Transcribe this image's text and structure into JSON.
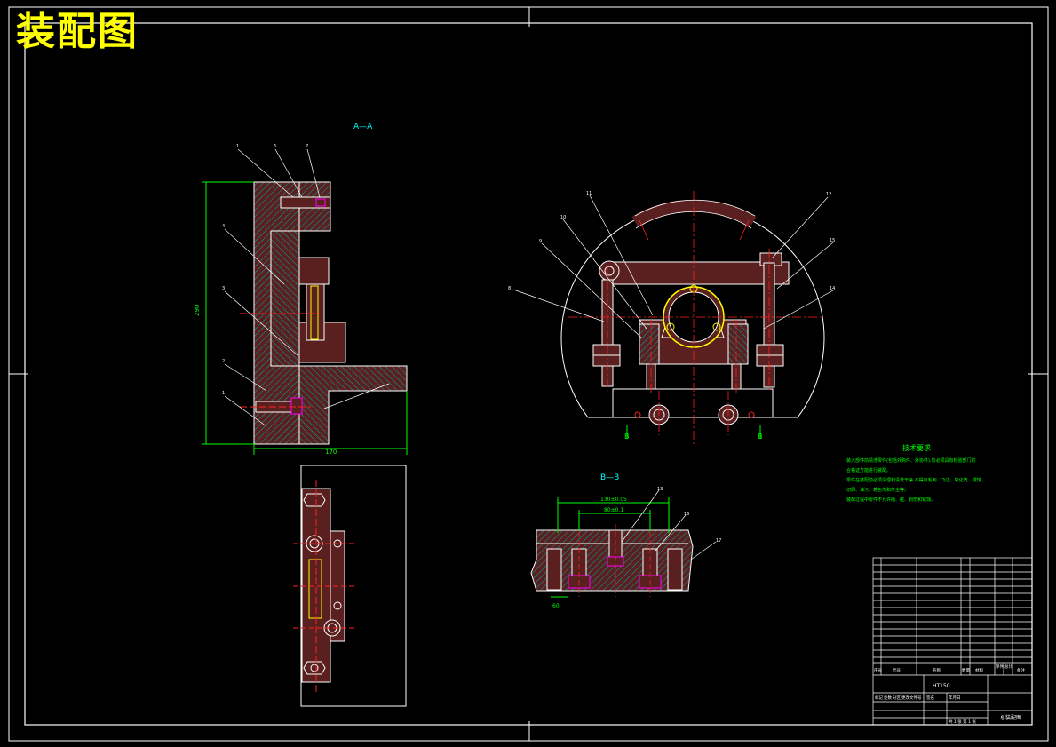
{
  "title": "装配图",
  "views": {
    "section_aa": "A—A",
    "section_bb": "B—B",
    "cut_mark": "B"
  },
  "dimensions": {
    "left_height": "290",
    "left_width": "170",
    "bb_outer": "130±0.05",
    "bb_inner": "80±0.1",
    "bb_side": "60"
  },
  "part_balloons_left": [
    "1",
    "6",
    "7",
    "4",
    "3",
    "2",
    "1"
  ],
  "part_balloons_right": [
    "11",
    "12",
    "10",
    "9",
    "15",
    "14",
    "8"
  ],
  "bb_balloons": [
    "13",
    "16",
    "17"
  ],
  "technical_requirements": {
    "heading": "技术要求",
    "lines": [
      "装入部件前清洗零件(包括外购件、外协件),均必须具有检验部门的",
      "合格证方能进行装配。",
      "零件在装配前必须清理和清洗干净,不得有毛刺、飞边、氧化皮、锈蚀、",
      "切屑、油污、着色剂和灰尘等。",
      "装配过程中零件不允许磕、碰、划伤和锈蚀。"
    ]
  },
  "title_block": {
    "header": [
      "序号",
      "代号",
      "名称",
      "数量",
      "材料",
      "单件",
      "总计",
      "备注"
    ],
    "center_label": "HT150",
    "drawing_name": "总装配图",
    "sub_labels": [
      "标记",
      "处数",
      "分区",
      "更改文件号",
      "签名",
      "年月日"
    ],
    "sheet_info": "共 1 张 第 1 张"
  },
  "colors": {
    "background": "#000000",
    "outline": "#ffffff",
    "part": "#5a1f1f",
    "hatch": "#00a8a8",
    "centerline": "#ff2020",
    "dimension": "#00ff00",
    "title": "#ffff00",
    "note": "#00ff00"
  }
}
